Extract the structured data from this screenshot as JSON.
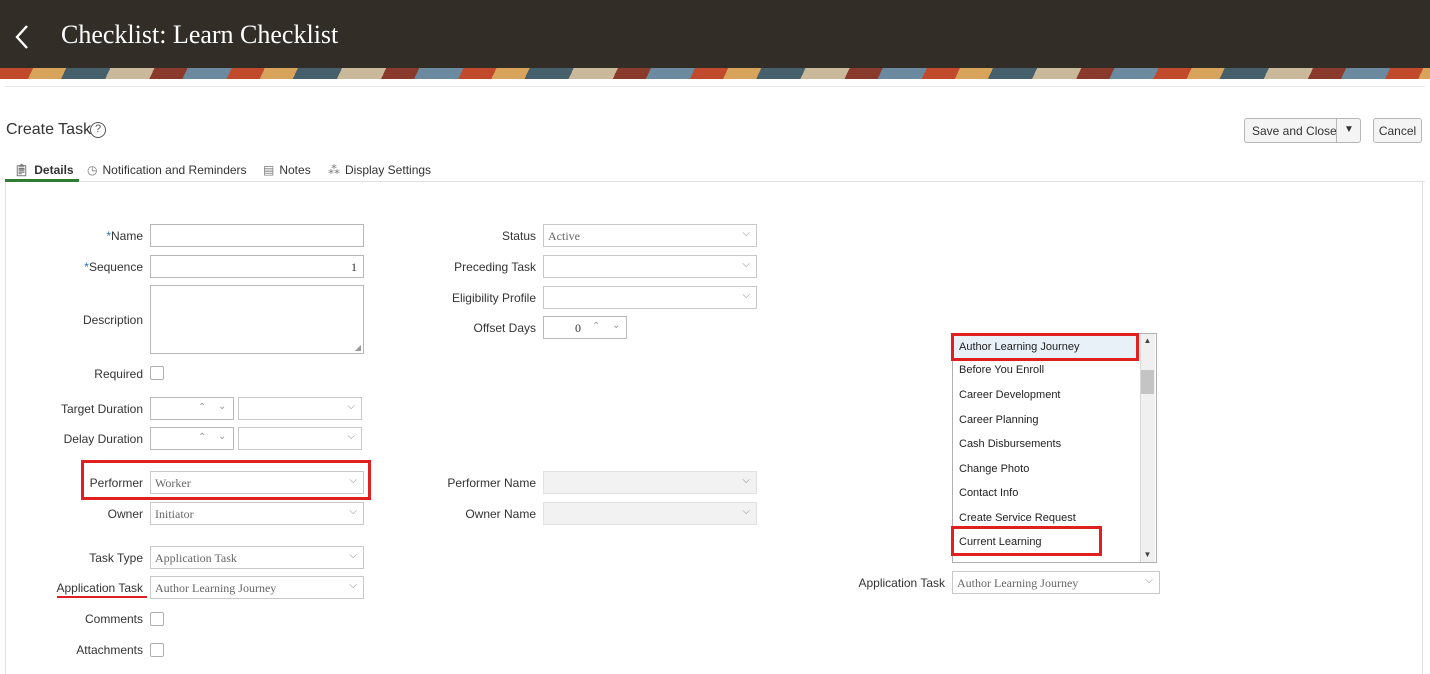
{
  "header": {
    "title": "Checklist: Learn Checklist"
  },
  "page": {
    "title": "Create Task",
    "save_label": "Save and Close",
    "cancel_label": "Cancel"
  },
  "tabs": [
    {
      "label": "Details",
      "icon": "clipboard-icon"
    },
    {
      "label": "Notification and Reminders",
      "icon": "clock-icon"
    },
    {
      "label": "Notes",
      "icon": "note-icon"
    },
    {
      "label": "Display Settings",
      "icon": "users-icon"
    }
  ],
  "form": {
    "name_label": "Name",
    "name_value": "",
    "sequence_label": "Sequence",
    "sequence_value": "1",
    "description_label": "Description",
    "required_label": "Required",
    "target_duration_label": "Target Duration",
    "delay_duration_label": "Delay Duration",
    "performer_label": "Performer",
    "performer_value": "Worker",
    "owner_label": "Owner",
    "owner_value": "Initiator",
    "task_type_label": "Task Type",
    "task_type_value": "Application Task",
    "application_task_label": "Application Task",
    "application_task_value": "Author Learning Journey",
    "comments_label": "Comments",
    "attachments_label": "Attachments",
    "status_label": "Status",
    "status_value": "Active",
    "preceding_task_label": "Preceding Task",
    "eligibility_profile_label": "Eligibility Profile",
    "offset_days_label": "Offset Days",
    "offset_days_value": "0",
    "performer_name_label": "Performer Name",
    "owner_name_label": "Owner Name"
  },
  "callout": {
    "application_task_label": "Application Task",
    "application_task_value": "Author Learning Journey",
    "options": [
      "Author Learning Journey",
      "Before You Enroll",
      "Career Development",
      "Career Planning",
      "Cash Disbursements",
      "Change Photo",
      "Contact Info",
      "Create Service Request",
      "Current Learning"
    ]
  },
  "colors": {
    "header_bg": "#332d28",
    "tab_active": "#2e7d32",
    "highlight": "#e02020",
    "required_star": "#2070c0"
  }
}
